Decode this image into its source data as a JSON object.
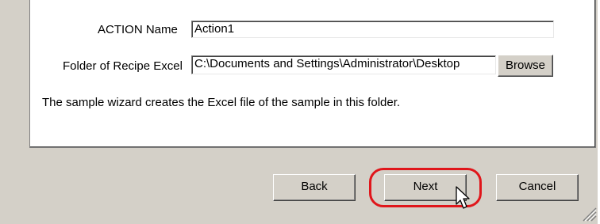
{
  "form": {
    "action_name_label": "ACTION Name",
    "action_name_value": "Action1",
    "folder_label": "Folder of Recipe Excel",
    "folder_value": "C:\\Documents and Settings\\Administrator\\Desktop",
    "browse_label": "Browse",
    "info_text": "The sample wizard creates the Excel file of the sample in this folder."
  },
  "footer": {
    "back_label": "Back",
    "next_label": "Next",
    "cancel_label": "Cancel"
  },
  "colors": {
    "dialog_bg": "#d4d0c8",
    "highlight": "#e0161b"
  },
  "icons": [
    "resize-grip-icon",
    "mouse-pointer-icon"
  ]
}
